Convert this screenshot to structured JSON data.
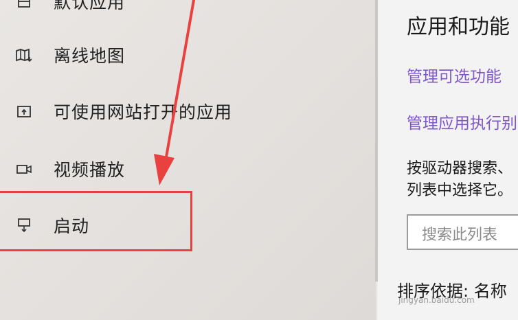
{
  "sidebar": {
    "items": [
      {
        "label": "默认应用",
        "icon": "default-apps-icon"
      },
      {
        "label": "离线地图",
        "icon": "offline-map-icon"
      },
      {
        "label": "可使用网站打开的应用",
        "icon": "apps-for-websites-icon"
      },
      {
        "label": "视频播放",
        "icon": "video-playback-icon"
      },
      {
        "label": "启动",
        "icon": "startup-icon"
      }
    ]
  },
  "annotation": {
    "color": "#e8413f"
  },
  "main": {
    "title": "应用和功能",
    "link_optional_features": "管理可选功能",
    "link_app_execution": "管理应用执行别",
    "description_line1": "按驱动器搜索、",
    "description_line2": "列表中选择它。",
    "search_placeholder": "搜索此列表",
    "sort_label": "排序依据: 名称",
    "watermark": "jingyan.baidu.com"
  },
  "colors": {
    "link": "#7f57c8",
    "accent_red": "#e8413f"
  }
}
